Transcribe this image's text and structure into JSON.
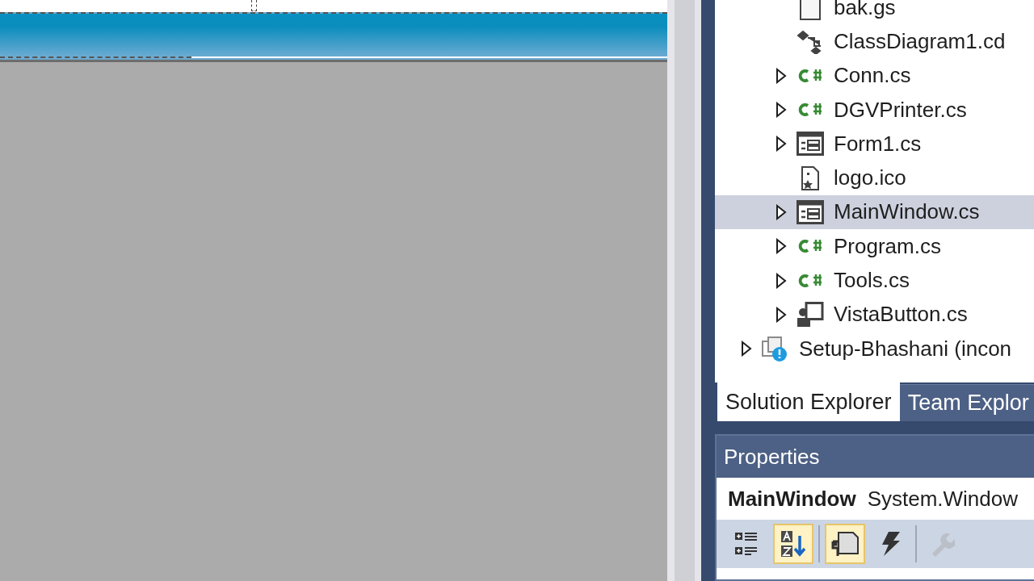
{
  "solution_explorer": {
    "tree": [
      {
        "children": [
          {
            "label": "bak.gs",
            "kind": "file",
            "expandable": false,
            "selected": false
          },
          {
            "label": "ClassDiagram1.cd",
            "kind": "diagram",
            "expandable": false,
            "selected": false
          },
          {
            "label": "Conn.cs",
            "kind": "csharp",
            "expandable": true,
            "selected": false
          },
          {
            "label": "DGVPrinter.cs",
            "kind": "csharp",
            "expandable": true,
            "selected": false
          },
          {
            "label": "Form1.cs",
            "kind": "form",
            "expandable": true,
            "selected": false
          },
          {
            "label": "logo.ico",
            "kind": "image",
            "expandable": false,
            "selected": false
          },
          {
            "label": "MainWindow.cs",
            "kind": "form",
            "expandable": true,
            "selected": true
          },
          {
            "label": "Program.cs",
            "kind": "csharp",
            "expandable": true,
            "selected": false
          },
          {
            "label": "Tools.cs",
            "kind": "csharp",
            "expandable": true,
            "selected": false
          },
          {
            "label": "VistaButton.cs",
            "kind": "control",
            "expandable": true,
            "selected": false
          }
        ]
      },
      {
        "label": "Setup-Bhashani (incon",
        "kind": "setup",
        "expandable": true,
        "selected": false
      }
    ],
    "tabs": [
      {
        "label": "Solution Explorer",
        "selected": true
      },
      {
        "label": "Team Explor",
        "selected": false
      }
    ]
  },
  "properties": {
    "title": "Properties",
    "object_name": "MainWindow",
    "object_type": "System.Window",
    "toolbar": [
      {
        "kind": "categorized",
        "selected": false,
        "disabled": false
      },
      {
        "kind": "alphabetical",
        "selected": true,
        "disabled": false
      },
      {
        "kind": "separator"
      },
      {
        "kind": "properties",
        "selected": true,
        "disabled": false
      },
      {
        "kind": "events",
        "selected": false,
        "disabled": false
      },
      {
        "kind": "separator"
      },
      {
        "kind": "property-pages",
        "selected": false,
        "disabled": true
      }
    ]
  }
}
